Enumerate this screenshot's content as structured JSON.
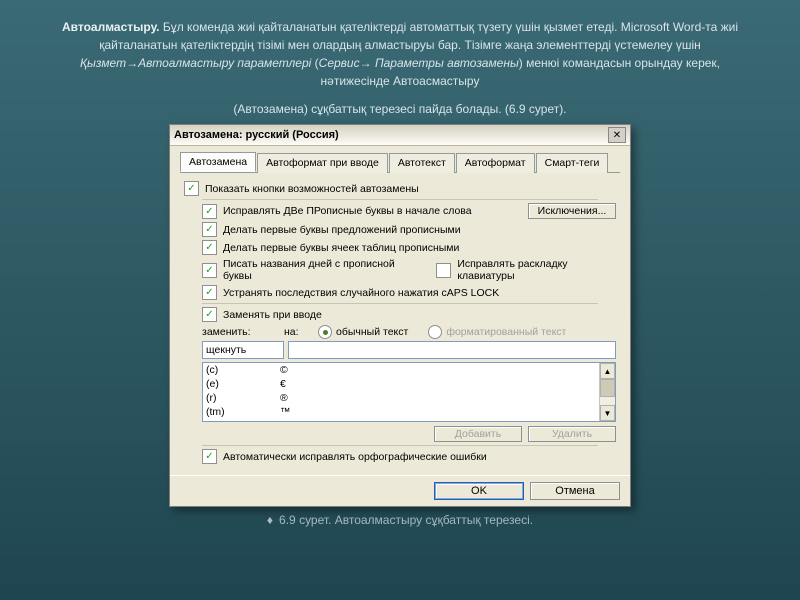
{
  "slide": {
    "para1_bold": "Автоалмастыру.",
    "para1_rest": " Бұл коменда жиі қайталанатын қателіктерді автоматтық түзету үшін қызмет етеді. Microsoft Word-та жиі қайталанатын қателіктердің тізімі мен олардың алмастыруы бар. Тізімге жаңа элементтерді үстемелеу үшін ",
    "para1_italic": "Қызмет→Автоалмастыру параметлері",
    "para1_paren_open": " (",
    "para1_italic2": "Сервис→ Параметры автозамены",
    "para1_paren_close": ")",
    "para1_end": " менюі командасын орындау керек, нәтижесінде Автоасмастыру",
    "para2": "(Автозамена) сұқбаттық терезесі пайда болады. (6.9 сурет).",
    "caption": "6.9 сурет. Автоалмастыру сұқбаттық терезесі."
  },
  "dialog": {
    "title": "Автозамена: русский (Россия)",
    "tabs": [
      "Автозамена",
      "Автоформат при вводе",
      "Автотекст",
      "Автоформат",
      "Смарт-теги"
    ],
    "cb_show_btn": "Показать кнопки возможностей автозамены",
    "cb_two_caps": "Исправлять ДВе ПРописные буквы в начале слова",
    "btn_exceptions": "Исключения...",
    "cb_sentence": "Делать первые буквы предложений прописными",
    "cb_tablecell": "Делать первые буквы ячеек таблиц прописными",
    "cb_days": "Писать названия дней с прописной буквы",
    "cb_keyboard": "Исправлять раскладку клавиатуры",
    "cb_capslock": "Устранять последствия случайного нажатия cAPS LOCK",
    "cb_replace": "Заменять при вводе",
    "lbl_replace": "заменить:",
    "lbl_with": "на:",
    "radio_plain": "обычный текст",
    "radio_formatted": "форматированный текст",
    "input_replace_value": "щекнуть",
    "list": [
      {
        "k": "(c)",
        "v": "©"
      },
      {
        "k": "(e)",
        "v": "€"
      },
      {
        "k": "(r)",
        "v": "®"
      },
      {
        "k": "(tm)",
        "v": "™"
      }
    ],
    "btn_add": "Добавить",
    "btn_delete": "Удалить",
    "cb_spelling": "Автоматически исправлять орфографические ошибки",
    "btn_ok": "OK",
    "btn_cancel": "Отмена"
  }
}
